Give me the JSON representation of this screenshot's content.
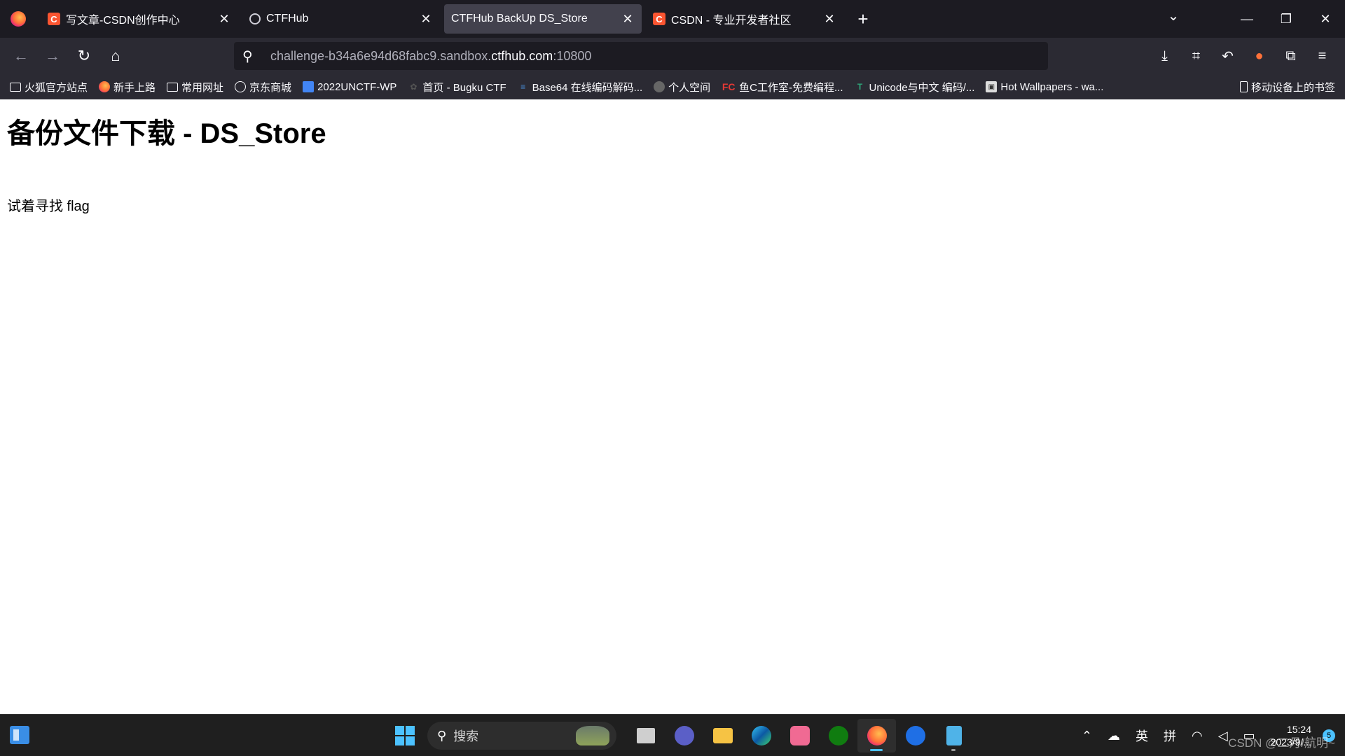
{
  "browser": {
    "tabs": [
      {
        "label": "写文章-CSDN创作中心",
        "favicon": "csdn-icon",
        "active": false
      },
      {
        "label": "CTFHub",
        "favicon": "ctfhub-icon",
        "active": false
      },
      {
        "label": "CTFHub BackUp DS_Store",
        "favicon": "",
        "active": true
      },
      {
        "label": "CSDN - 专业开发者社区",
        "favicon": "csdn-icon",
        "active": false
      }
    ],
    "csdn_favicon_letter": "C",
    "url": {
      "prefix": "challenge-b34a6e94d68fabc9.sandbox.",
      "host": "ctfhub.com",
      "suffix": ":10800"
    },
    "bookmarks": [
      {
        "label": "火狐官方站点",
        "icon": "folder-icon"
      },
      {
        "label": "新手上路",
        "icon": "firefox-icon"
      },
      {
        "label": "常用网址",
        "icon": "folder-icon"
      },
      {
        "label": "京东商城",
        "icon": "globe-icon"
      },
      {
        "label": "2022UNCTF-WP",
        "icon": "doc-icon"
      },
      {
        "label": "首页 - Bugku CTF",
        "icon": "paw-icon"
      },
      {
        "label": "Base64 在线编码解码...",
        "icon": "lines-icon"
      },
      {
        "label": "个人空间",
        "icon": "globe-icon"
      },
      {
        "label": "鱼C工作室-免费编程...",
        "icon": "fc-icon"
      },
      {
        "label": "Unicode与中文 编码/...",
        "icon": "tee-icon"
      },
      {
        "label": "Hot Wallpapers - wa...",
        "icon": "wallpaper-icon"
      }
    ],
    "fc_icon_text": "FC",
    "mobile_bookmarks": "移动设备上的书签"
  },
  "page": {
    "heading": "备份文件下载 - DS_Store",
    "text": "试着寻找 flag"
  },
  "taskbar": {
    "search_placeholder": "搜索",
    "tray_ime_lang": "英",
    "tray_ime_mode": "拼",
    "clock_time": "15:24",
    "clock_date": "2023/9/...",
    "notification_count": "5",
    "watermark": "CSDN @二月/航明~"
  },
  "colors": {
    "tab_bg": "#1c1b22",
    "toolbar_bg": "#2b2a33",
    "active_tab": "#42414d",
    "accent": "#4cc2ff",
    "csdn": "#fc5531"
  }
}
